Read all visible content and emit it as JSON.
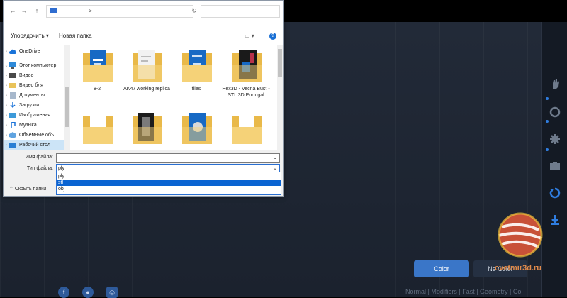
{
  "background_app": {
    "color_button_label": "Color",
    "second_button_label": "Ne Color",
    "watermark_text": "cvetmir3d.ru",
    "status_text": "Normal | Modifiers | Fast | Geometry | Col",
    "bottom_left_text": "",
    "accent": "#3a76c8",
    "tools": [
      "hand-icon",
      "rotate-icon",
      "move-icon",
      "camera-icon",
      "refresh-icon",
      "download-icon"
    ]
  },
  "dialog": {
    "address_crumbs": "··· ··········  >  ···· ·· ·· ··",
    "toolbar": {
      "organize": "Упорядочить ▾",
      "new_folder": "Новая папка"
    },
    "nav_items": [
      {
        "label": "OneDrive",
        "icon": "cloud-icon"
      },
      {
        "label": "Этот компьютер",
        "icon": "computer-icon"
      },
      {
        "label": "Видео",
        "icon": "video-icon"
      },
      {
        "label": "Видео бля",
        "icon": "folder-icon"
      },
      {
        "label": "Документы",
        "icon": "documents-icon"
      },
      {
        "label": "Загрузки",
        "icon": "downloads-icon"
      },
      {
        "label": "Изображения",
        "icon": "pictures-icon"
      },
      {
        "label": "Музыка",
        "icon": "music-icon"
      },
      {
        "label": "Объемные объ",
        "icon": "3d-objects-icon"
      },
      {
        "label": "Рабочий стол",
        "icon": "desktop-icon"
      }
    ],
    "files": [
      {
        "name": "8-2",
        "kind": "folder-doc"
      },
      {
        "name": "AK47 working replica",
        "kind": "folder-paper"
      },
      {
        "name": "files",
        "kind": "folder-doc"
      },
      {
        "name": "Hex3D - Vecna Bust - STL 3D Portugal",
        "kind": "folder-dark"
      },
      {
        "name": "",
        "kind": "folder-plain"
      },
      {
        "name": "",
        "kind": "folder-figure"
      },
      {
        "name": "",
        "kind": "folder-gear"
      },
      {
        "name": "",
        "kind": "folder-plain"
      }
    ],
    "filename_label": "Имя файла:",
    "filename_value": "",
    "filetype_label": "Тип файла:",
    "filetype_value": "ply",
    "filetype_options": [
      "ply",
      "stl",
      "obj"
    ],
    "highlighted_option": "stl",
    "hide_folders": "Скрыть папки"
  }
}
